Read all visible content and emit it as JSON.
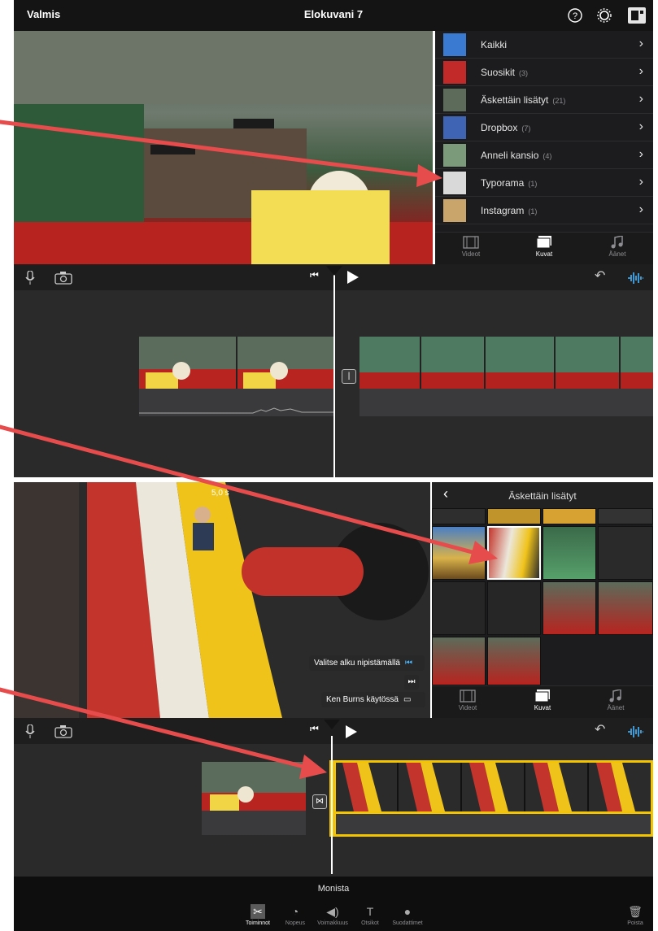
{
  "top_bar": {
    "done_label": "Valmis",
    "title": "Elokuvani 7",
    "icons": [
      "help-icon",
      "settings-icon",
      "project-settings-icon"
    ]
  },
  "library": {
    "rows": [
      {
        "label": "Kaikki",
        "count": ""
      },
      {
        "label": "Suosikit",
        "count": "(3)"
      },
      {
        "label": "Äskettäin lisätyt",
        "count": "(21)"
      },
      {
        "label": "Dropbox",
        "count": "(7)"
      },
      {
        "label": "Anneli kansio",
        "count": "(4)"
      },
      {
        "label": "Typorama",
        "count": "(1)"
      },
      {
        "label": "Instagram",
        "count": "(1)"
      }
    ],
    "tabs": [
      "Videot",
      "Kuvat",
      "Äänet"
    ]
  },
  "recent_panel": {
    "title": "Äskettäin lisätyt",
    "tabs": [
      "Videot",
      "Kuvat",
      "Äänet"
    ]
  },
  "preview2": {
    "duration_label": "5,0 s",
    "hint_start": "Valitse alku nipistämällä",
    "hint_ken_burns": "Ken Burns käytössä"
  },
  "bottom_toolbar": {
    "title": "Monista",
    "tools": [
      "Toiminnot",
      "Nopeus",
      "Voimakkuus",
      "Otsikot",
      "Suodattimet"
    ],
    "delete_label": "Poista"
  },
  "colors": {
    "accent": "#4ab6ff",
    "clip_selected": "#f5c400",
    "annotation": "#e74c4c"
  }
}
